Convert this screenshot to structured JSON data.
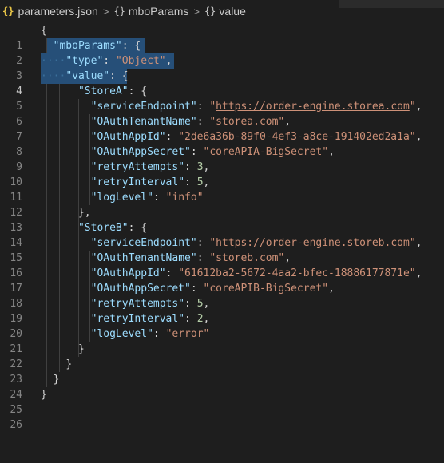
{
  "breadcrumb": {
    "file_icon": "{}",
    "file_name": "parameters.json",
    "obj_icon": "{}",
    "item1": "mboParams",
    "item2": "value",
    "separator": ">"
  },
  "editor": {
    "line_numbers": [
      "1",
      "2",
      "3",
      "4",
      "5",
      "6",
      "7",
      "8",
      "9",
      "10",
      "11",
      "12",
      "13",
      "14",
      "15",
      "16",
      "17",
      "18",
      "19",
      "20",
      "21",
      "22",
      "23",
      "24",
      "25",
      "26"
    ],
    "active_line": "4",
    "code": {
      "l1": "{",
      "l2_key": "\"mboParams\"",
      "l2_rest": ": {",
      "l3_key": "\"type\"",
      "l3_colon": ": ",
      "l3_val": "\"Object\"",
      "l3_comma": ",",
      "l4_key": "\"value\"",
      "l4_rest": ": {",
      "storeA_key": "\"StoreA\"",
      "storeA_rest": ": {",
      "a_se_key": "\"serviceEndpoint\"",
      "a_se_q1": "\"",
      "a_se_url": "https://order-engine.storea.com",
      "a_se_q2": "\"",
      "a_tn_key": "\"OAuthTenantName\"",
      "a_tn_val": "\"storea.com\"",
      "a_ai_key": "\"OAuthAppId\"",
      "a_ai_val": "\"2de6a36b-89f0-4ef3-a8ce-191402ed2a1a\"",
      "a_as_key": "\"OAuthAppSecret\"",
      "a_as_val": "\"coreAPIA-BigSecret\"",
      "a_ra_key": "\"retryAttempts\"",
      "a_ra_val": "3",
      "a_ri_key": "\"retryInterval\"",
      "a_ri_val": "5",
      "a_ll_key": "\"logLevel\"",
      "a_ll_val": "\"info\"",
      "close_comma": "},",
      "storeB_key": "\"StoreB\"",
      "storeB_rest": ": {",
      "b_se_key": "\"serviceEndpoint\"",
      "b_se_q1": "\"",
      "b_se_url": "https://order-engine.storeb.com",
      "b_se_q2": "\"",
      "b_tn_key": "\"OAuthTenantName\"",
      "b_tn_val": "\"storeb.com\"",
      "b_ai_key": "\"OAuthAppId\"",
      "b_ai_val": "\"61612ba2-5672-4aa2-bfec-18886177871e\"",
      "b_as_key": "\"OAuthAppSecret\"",
      "b_as_val": "\"coreAPIB-BigSecret\"",
      "b_ra_key": "\"retryAttempts\"",
      "b_ra_val": "5",
      "b_ri_key": "\"retryInterval\"",
      "b_ri_val": "2",
      "b_ll_key": "\"logLevel\"",
      "b_ll_val": "\"error\"",
      "close": "}"
    }
  },
  "colors": {
    "background": "#1e1e1e",
    "key": "#9cdcfe",
    "string": "#ce9178",
    "number": "#b5cea8",
    "selection": "#264f78"
  }
}
